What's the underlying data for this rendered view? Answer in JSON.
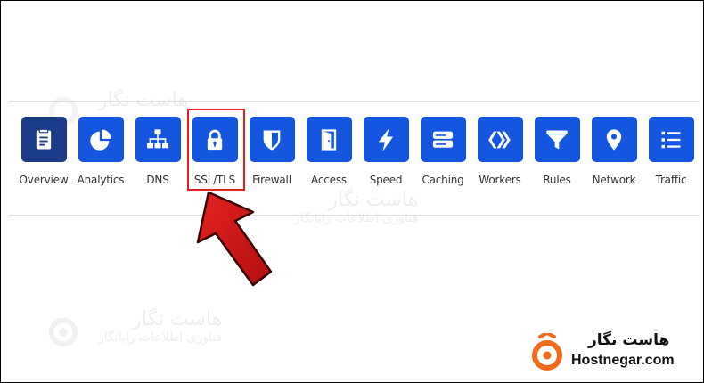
{
  "toolbar": {
    "items": [
      {
        "label": "Overview",
        "icon": "document-icon",
        "state": "active"
      },
      {
        "label": "Analytics",
        "icon": "pie-chart-icon"
      },
      {
        "label": "DNS",
        "icon": "network-tree-icon"
      },
      {
        "label": "SSL/TLS",
        "icon": "lock-icon",
        "state": "highlighted"
      },
      {
        "label": "Firewall",
        "icon": "shield-icon"
      },
      {
        "label": "Access",
        "icon": "door-icon"
      },
      {
        "label": "Speed",
        "icon": "lightning-icon"
      },
      {
        "label": "Caching",
        "icon": "server-icon"
      },
      {
        "label": "Workers",
        "icon": "workers-chevrons-icon"
      },
      {
        "label": "Rules",
        "icon": "filter-icon"
      },
      {
        "label": "Network",
        "icon": "location-pin-icon"
      },
      {
        "label": "Traffic",
        "icon": "list-icon"
      }
    ]
  },
  "watermark": {
    "title": "هاست نگار",
    "subtitle": "فناوری اطلاعات رایانگار"
  },
  "brand": {
    "name_fa": "هاست نگار",
    "name_en": "Hostnegar.com"
  },
  "colors": {
    "tile": "#1556e0",
    "tile_active": "#1a3a8a",
    "highlight": "#e02020",
    "arrow": "#d11616",
    "brand_orange": "#f26a1b"
  }
}
